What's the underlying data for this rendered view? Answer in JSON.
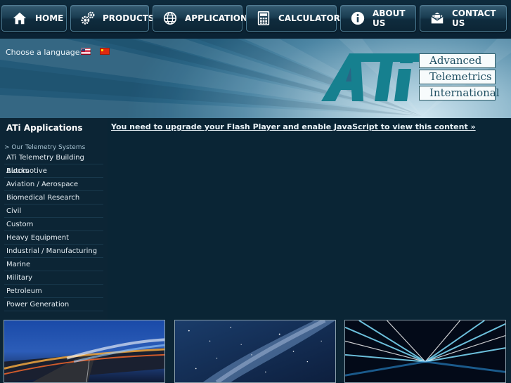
{
  "nav": {
    "items": [
      {
        "label": "HOME",
        "icon": "home-icon"
      },
      {
        "label": "PRODUCTS",
        "icon": "gears-icon"
      },
      {
        "label": "APPLICATIONS",
        "icon": "globe-icon"
      },
      {
        "label": "CALCULATORS",
        "icon": "calculator-icon"
      },
      {
        "label": "ABOUT US",
        "icon": "info-icon"
      },
      {
        "label": "CONTACT US",
        "icon": "envelope-icon"
      }
    ]
  },
  "header": {
    "language_label": "Choose a language:",
    "flags": [
      "us-flag-icon",
      "china-flag-icon"
    ],
    "logo": {
      "mark": "ATi",
      "lines": [
        "Advanced",
        "Telemetrics",
        "International"
      ],
      "color": "#1a7f8e"
    }
  },
  "sidebar": {
    "title": "ATi Applications",
    "subtitle": "> Our Telemetry Systems",
    "items": [
      "ATi Telemetry Building Blocks",
      "Automotive",
      "Aviation / Aerospace",
      "Biomedical Research",
      "Civil",
      "Custom",
      "Heavy Equipment",
      "Industrial / Manufacturing",
      "Marine",
      "Military",
      "Petroleum",
      "Power Generation"
    ]
  },
  "content": {
    "flash_notice": "You need to upgrade your Flash Player and enable JavaScript to view this content »"
  },
  "thumbnails": [
    "highway-night-image",
    "milky-way-image",
    "light-streaks-image"
  ],
  "colors": {
    "background": "#0c2535",
    "accent": "#1a7f8e"
  }
}
